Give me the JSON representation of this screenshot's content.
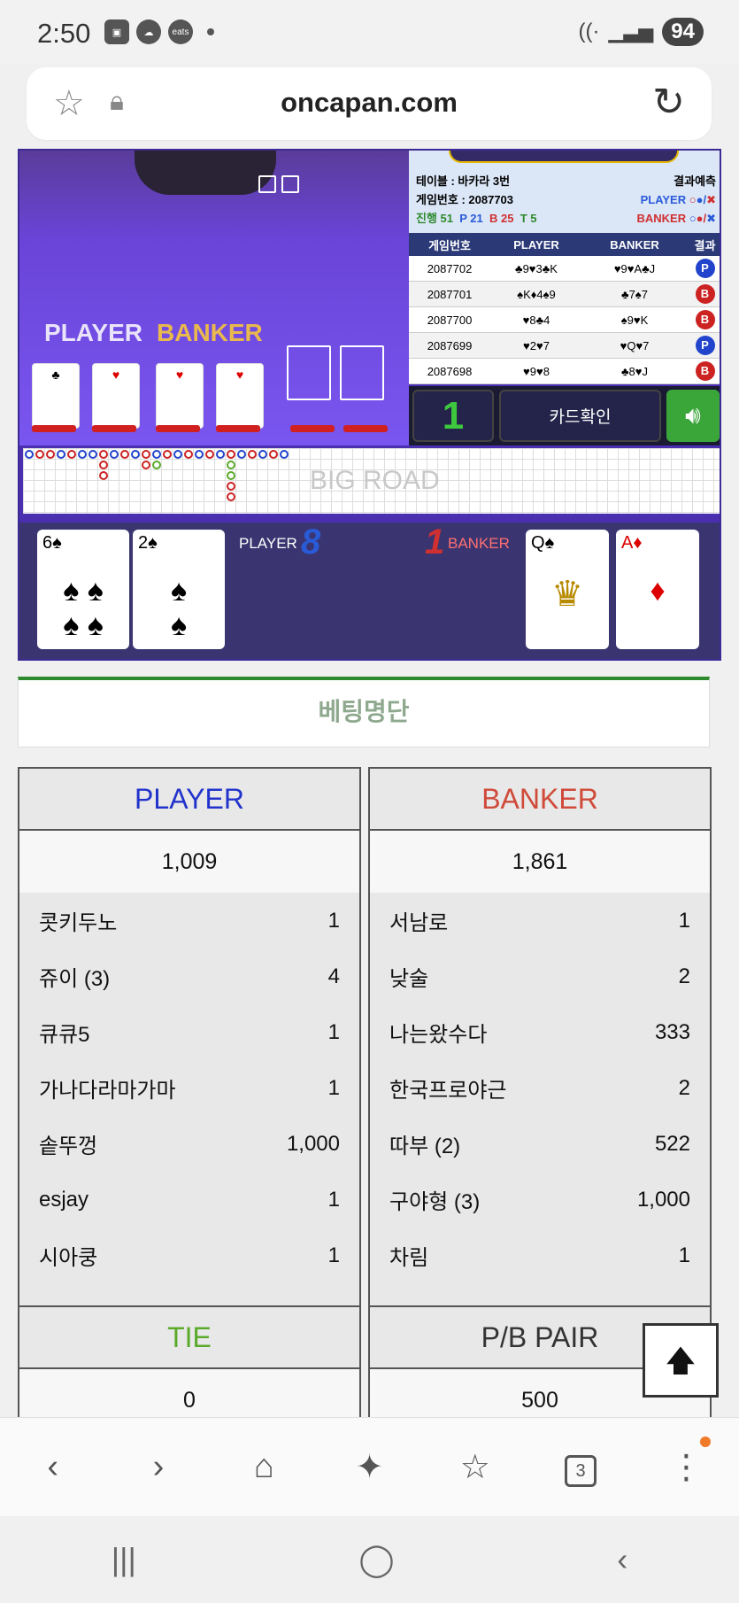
{
  "status": {
    "time": "2:50",
    "battery": "94",
    "eats_label": "eats"
  },
  "browser": {
    "url": "oncapan.com"
  },
  "stream": {
    "player_label": "PLAYER",
    "banker_label": "BANKER",
    "table_name": "테이블 : 바카라 3번",
    "game_no": "게임번호 : 2087703",
    "progress": "진행 51",
    "p_count": "P 21",
    "b_count": "B 25",
    "t_count": "T 5",
    "predict_label": "결과예측",
    "predict_player": "PLAYER",
    "predict_banker": "BANKER",
    "history_headers": [
      "게임번호",
      "PLAYER",
      "BANKER",
      "결과"
    ],
    "history": [
      {
        "no": "2087702",
        "player": "♣9♥3♣K",
        "banker": "♥9♥A♣J",
        "result": "P"
      },
      {
        "no": "2087701",
        "player": "♠K♦4♠9",
        "banker": "♣7♠7",
        "result": "B"
      },
      {
        "no": "2087700",
        "player": "♥8♣4",
        "banker": "♠9♥K",
        "result": "B"
      },
      {
        "no": "2087699",
        "player": "♥2♥7",
        "banker": "♥Q♥7",
        "result": "P"
      },
      {
        "no": "2087698",
        "player": "♥9♥8",
        "banker": "♣8♥J",
        "result": "B"
      }
    ],
    "round_number": "1",
    "card_check_label": "카드확인",
    "big_road_label": "BIG ROAD",
    "player_score_label": "PLAYER",
    "player_score": "8",
    "banker_score_label": "BANKER",
    "banker_score": "1",
    "player_cards": [
      {
        "rank": "6",
        "suit": "♠"
      },
      {
        "rank": "2",
        "suit": "♠"
      }
    ],
    "banker_cards": [
      {
        "rank": "Q",
        "suit": "♠"
      },
      {
        "rank": "A",
        "suit": "♦"
      }
    ]
  },
  "betting": {
    "title": "베팅명단",
    "player": {
      "label": "PLAYER",
      "total": "1,009",
      "rows": [
        {
          "name": "콧키두노",
          "value": "1"
        },
        {
          "name": "쥬이 (3)",
          "value": "4"
        },
        {
          "name": "큐큐5",
          "value": "1"
        },
        {
          "name": "가나다라마가마",
          "value": "1"
        },
        {
          "name": "솥뚜껑",
          "value": "1,000"
        },
        {
          "name": "esjay",
          "value": "1"
        },
        {
          "name": "시아쿵",
          "value": "1"
        }
      ]
    },
    "banker": {
      "label": "BANKER",
      "total": "1,861",
      "rows": [
        {
          "name": "서남로",
          "value": "1"
        },
        {
          "name": "낮술",
          "value": "2"
        },
        {
          "name": "나는왔수다",
          "value": "333"
        },
        {
          "name": "한국프로야근",
          "value": "2"
        },
        {
          "name": "따부 (2)",
          "value": "522"
        },
        {
          "name": "구야형 (3)",
          "value": "1,000"
        },
        {
          "name": "차림",
          "value": "1"
        }
      ]
    },
    "tie": {
      "label": "TIE",
      "total": "0"
    },
    "pair": {
      "label": "P/B PAIR",
      "total": "500"
    }
  },
  "nav": {
    "tab_count": "3"
  },
  "colors": {
    "player": "#2233cc",
    "banker": "#d04a3a",
    "tie": "#5aaa2a",
    "accent": "#2d8a2d"
  }
}
